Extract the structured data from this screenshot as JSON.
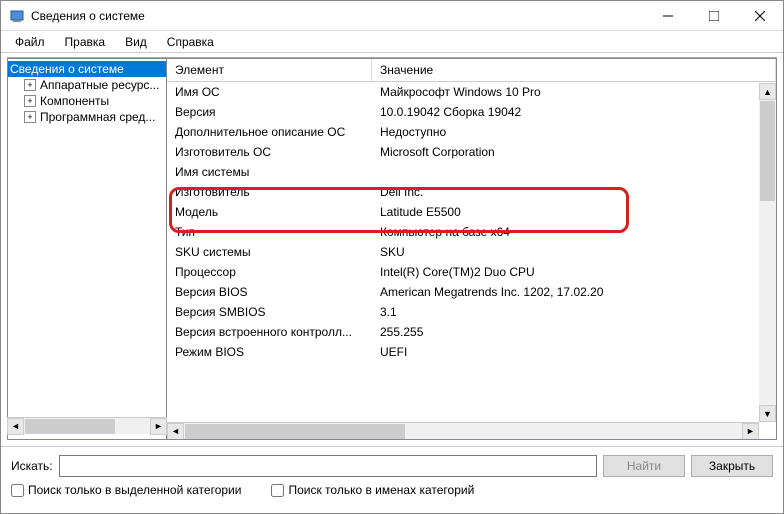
{
  "window": {
    "title": "Сведения о системе"
  },
  "menu": {
    "file": "Файл",
    "edit": "Правка",
    "view": "Вид",
    "help": "Справка"
  },
  "tree": {
    "root": "Сведения о системе",
    "n1": "Аппаратные ресурс...",
    "n2": "Компоненты",
    "n3": "Программная сред..."
  },
  "cols": {
    "element": "Элемент",
    "value": "Значение"
  },
  "rows": [
    {
      "k": "Имя ОС",
      "v": "Майкрософт Windows 10 Pro"
    },
    {
      "k": "Версия",
      "v": "10.0.19042 Сборка 19042"
    },
    {
      "k": "Дополнительное описание ОС",
      "v": "Недоступно"
    },
    {
      "k": "Изготовитель ОС",
      "v": "Microsoft Corporation"
    },
    {
      "k": "Имя системы",
      "v": ""
    },
    {
      "k": "Изготовитель",
      "v": "Dell Inc."
    },
    {
      "k": "Модель",
      "v": "Latitude E5500"
    },
    {
      "k": "Тип",
      "v": "Компьютер на базе x64"
    },
    {
      "k": "SKU системы",
      "v": "SKU"
    },
    {
      "k": "Процессор",
      "v": "Intel(R) Core(TM)2 Duo CPU"
    },
    {
      "k": "Версия BIOS",
      "v": "American Megatrends Inc. 1202, 17.02.20"
    },
    {
      "k": "Версия SMBIOS",
      "v": "3.1"
    },
    {
      "k": "Версия встроенного контролл...",
      "v": "255.255"
    },
    {
      "k": "Режим BIOS",
      "v": "UEFI"
    }
  ],
  "search": {
    "label": "Искать:",
    "placeholder": "",
    "find": "Найти",
    "close": "Закрыть",
    "cb1": "Поиск только в выделенной категории",
    "cb2": "Поиск только в именах категорий"
  }
}
